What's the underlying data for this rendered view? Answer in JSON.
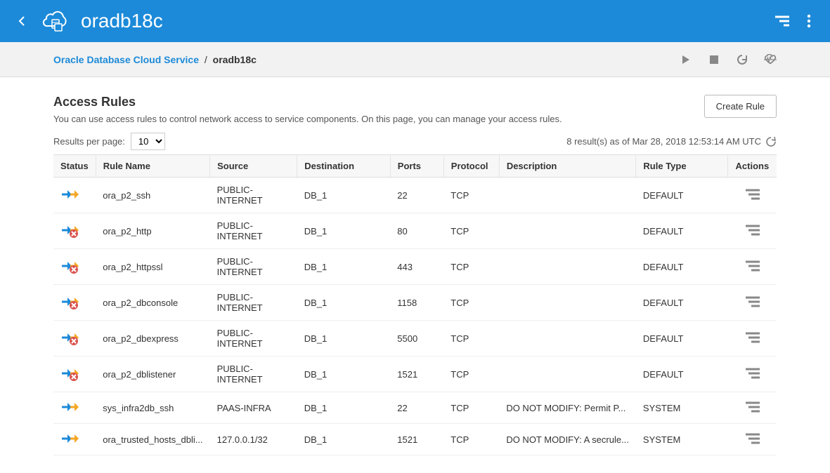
{
  "header": {
    "title": "oradb18c"
  },
  "breadcrumb": {
    "parent": "Oracle Database Cloud Service",
    "separator": "/",
    "current": "oradb18c"
  },
  "section": {
    "title": "Access Rules",
    "description": "You can use access rules to control network access to service components. On this page, you can manage your access rules.",
    "create_button": "Create Rule"
  },
  "meta": {
    "rpp_label": "Results per page:",
    "rpp_value": "10",
    "results_text": "8 result(s) as of Mar 28, 2018 12:53:14 AM UTC"
  },
  "columns": {
    "status": "Status",
    "rule_name": "Rule Name",
    "source": "Source",
    "destination": "Destination",
    "ports": "Ports",
    "protocol": "Protocol",
    "description": "Description",
    "rule_type": "Rule Type",
    "actions": "Actions"
  },
  "rows": [
    {
      "status": "enabled",
      "rule_name": "ora_p2_ssh",
      "source": "PUBLIC-INTERNET",
      "destination": "DB_1",
      "ports": "22",
      "protocol": "TCP",
      "description": "",
      "rule_type": "DEFAULT"
    },
    {
      "status": "disabled",
      "rule_name": "ora_p2_http",
      "source": "PUBLIC-INTERNET",
      "destination": "DB_1",
      "ports": "80",
      "protocol": "TCP",
      "description": "",
      "rule_type": "DEFAULT"
    },
    {
      "status": "disabled",
      "rule_name": "ora_p2_httpssl",
      "source": "PUBLIC-INTERNET",
      "destination": "DB_1",
      "ports": "443",
      "protocol": "TCP",
      "description": "",
      "rule_type": "DEFAULT"
    },
    {
      "status": "disabled",
      "rule_name": "ora_p2_dbconsole",
      "source": "PUBLIC-INTERNET",
      "destination": "DB_1",
      "ports": "1158",
      "protocol": "TCP",
      "description": "",
      "rule_type": "DEFAULT"
    },
    {
      "status": "disabled",
      "rule_name": "ora_p2_dbexpress",
      "source": "PUBLIC-INTERNET",
      "destination": "DB_1",
      "ports": "5500",
      "protocol": "TCP",
      "description": "",
      "rule_type": "DEFAULT"
    },
    {
      "status": "disabled",
      "rule_name": "ora_p2_dblistener",
      "source": "PUBLIC-INTERNET",
      "destination": "DB_1",
      "ports": "1521",
      "protocol": "TCP",
      "description": "",
      "rule_type": "DEFAULT"
    },
    {
      "status": "enabled",
      "rule_name": "sys_infra2db_ssh",
      "source": "PAAS-INFRA",
      "destination": "DB_1",
      "ports": "22",
      "protocol": "TCP",
      "description": "DO NOT MODIFY: Permit P...",
      "rule_type": "SYSTEM"
    },
    {
      "status": "enabled",
      "rule_name": "ora_trusted_hosts_dbli...",
      "source": "127.0.0.1/32",
      "destination": "DB_1",
      "ports": "1521",
      "protocol": "TCP",
      "description": "DO NOT MODIFY: A secrule...",
      "rule_type": "SYSTEM"
    }
  ]
}
